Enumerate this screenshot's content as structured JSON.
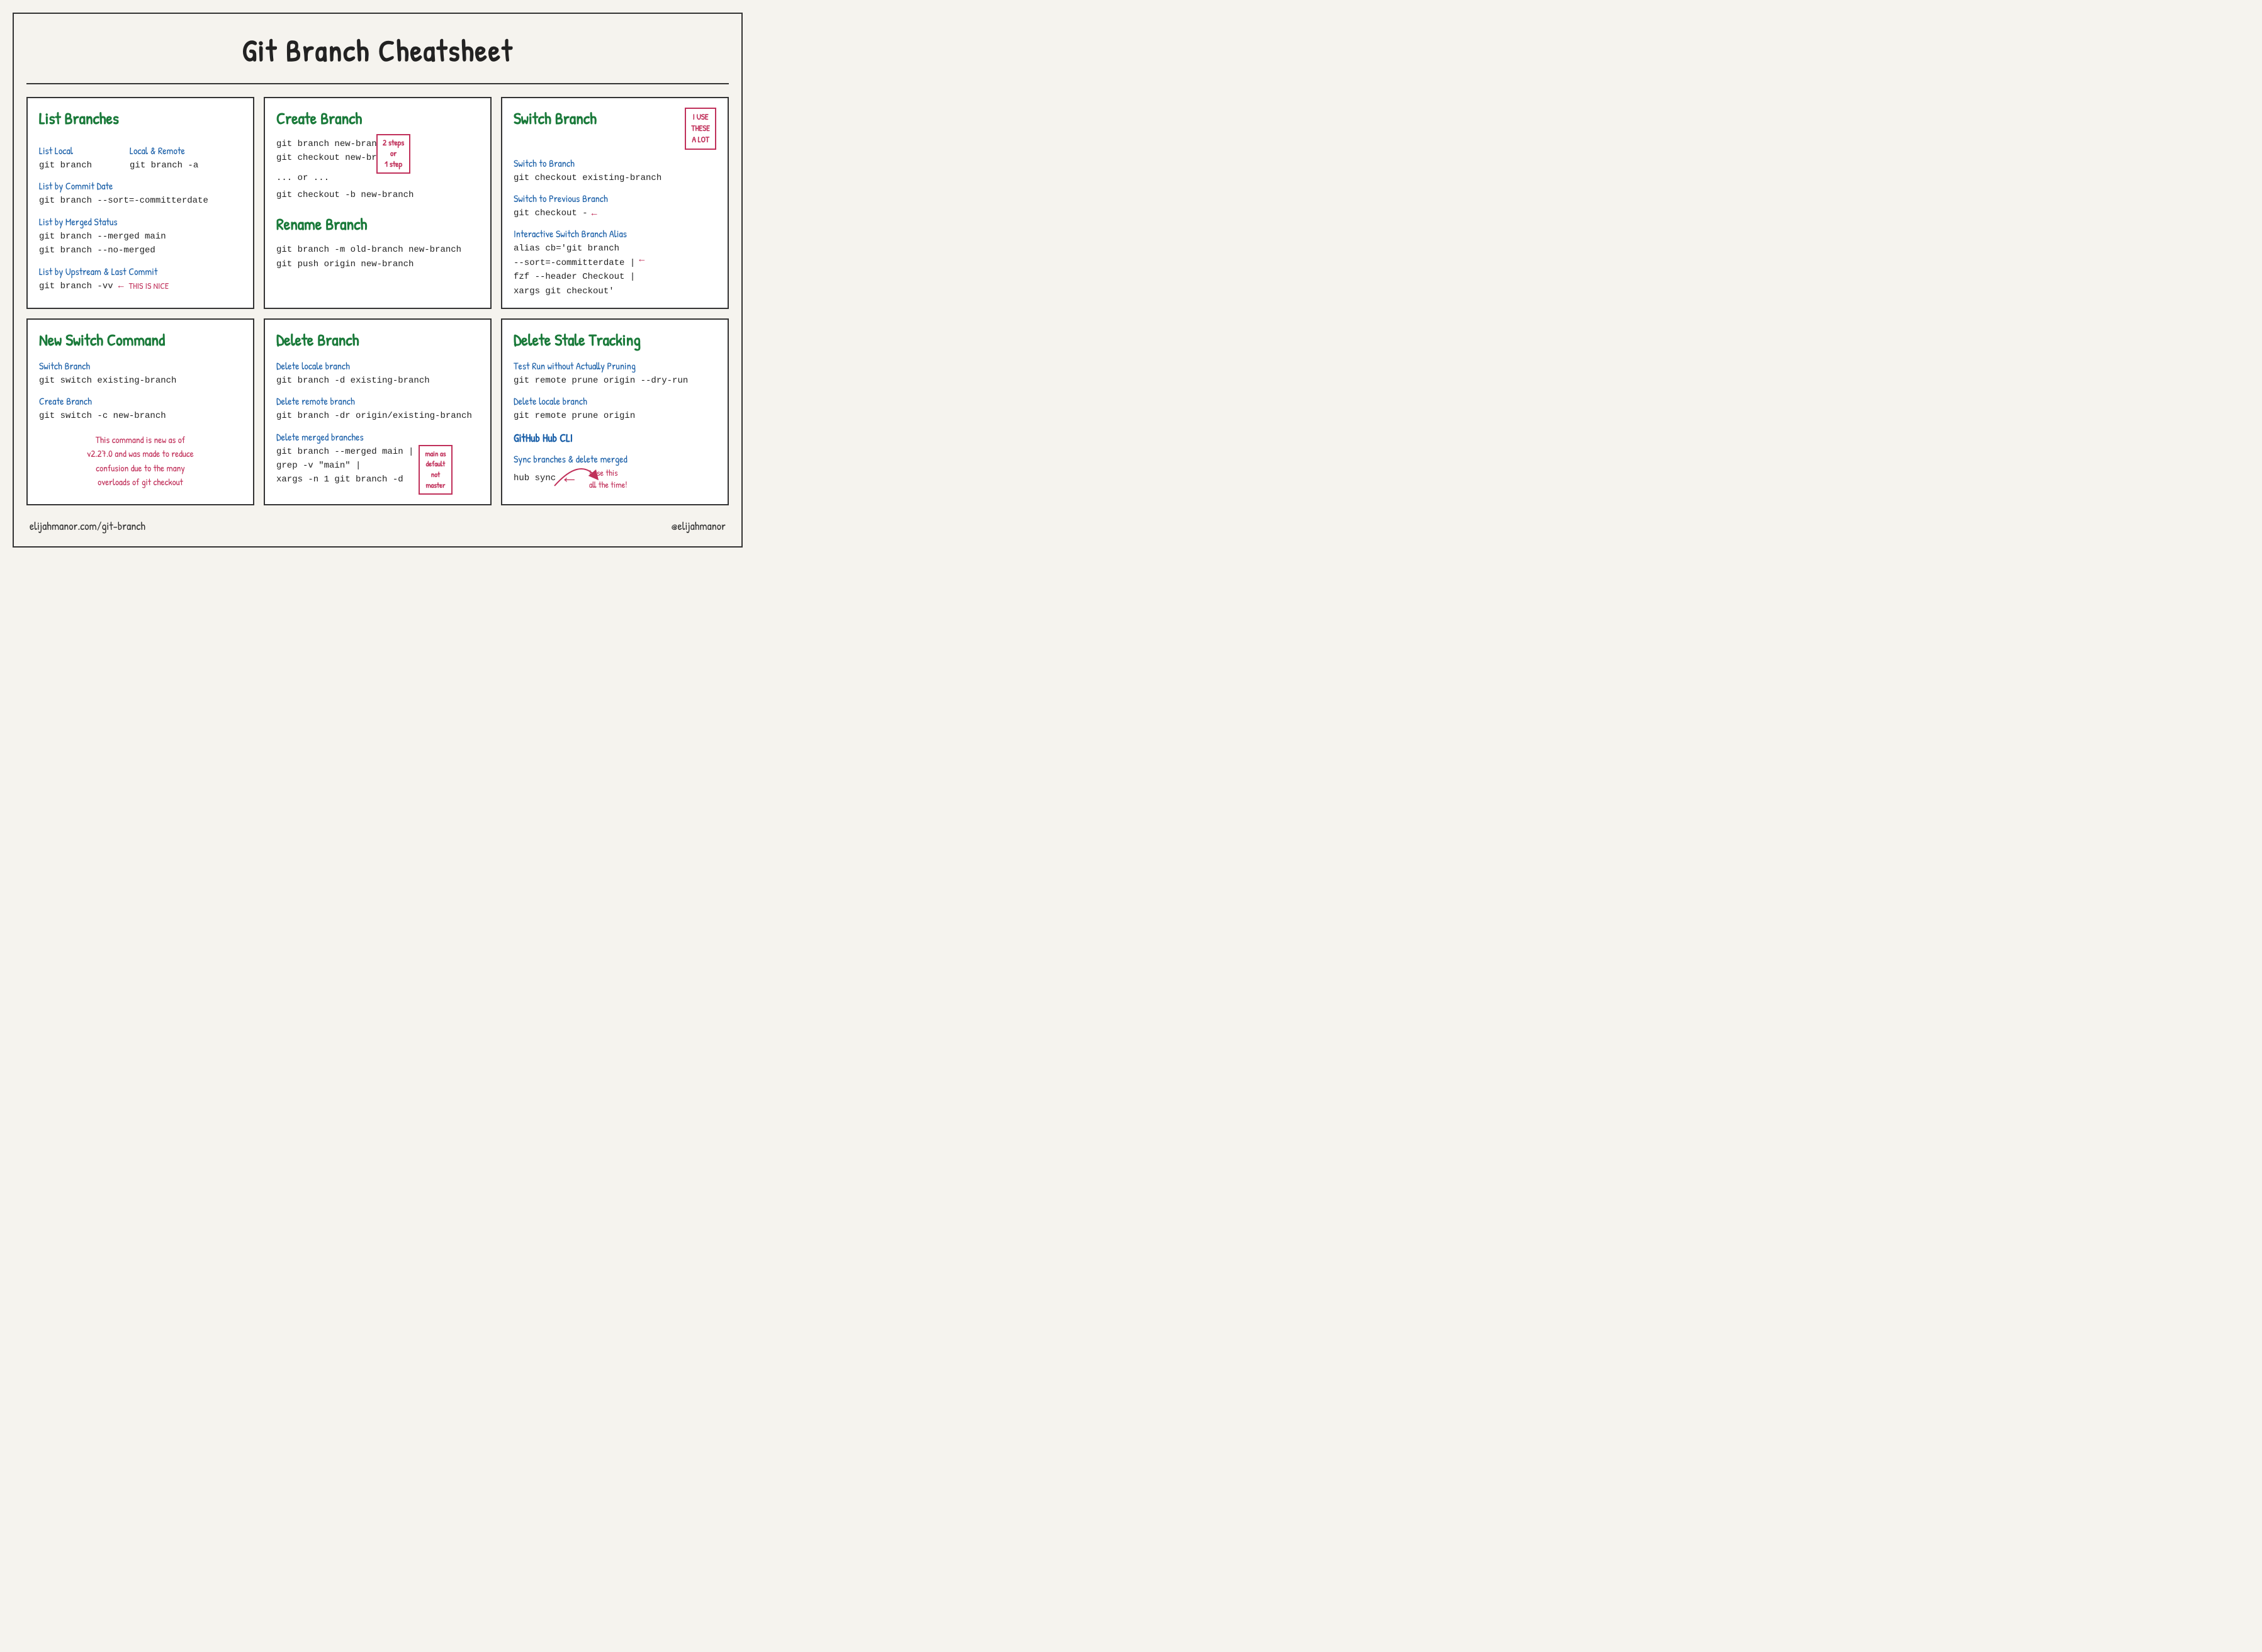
{
  "page": {
    "title": "Git Branch Cheatsheet",
    "footer_left": "elijahmanor.com/git-branch",
    "footer_right": "@elijahmanor"
  },
  "cards": {
    "list_branches": {
      "title": "List Branches",
      "sections": [
        {
          "label": "List Local",
          "label2": "Local & Remote",
          "code1": "git branch",
          "code2": "git branch -a"
        },
        {
          "label": "List by Commit Date",
          "code1": "git branch --sort=-committerdate"
        },
        {
          "label": "List by Merged Status",
          "code1": "git branch --merged main",
          "code2": "git branch --no-merged"
        },
        {
          "label": "List by Upstream & Last Commit",
          "code1": "git branch -vv",
          "annotation": "THIS IS NICE"
        }
      ]
    },
    "create_branch": {
      "title": "Create Branch",
      "code1": "git branch new-branch",
      "code2": "git checkout new-branch",
      "or_text": "... or ...",
      "code3": "git checkout -b new-branch",
      "annotation": "2 steps\nor\n1 step",
      "rename_title": "Rename Branch",
      "rename_code1": "git branch -m old-branch new-branch",
      "rename_code2": "git push origin new-branch"
    },
    "switch_branch": {
      "title": "Switch Branch",
      "badge": "I USE\nTHESE\nA LOT",
      "sections": [
        {
          "label": "Switch to Branch",
          "code": "git checkout existing-branch"
        },
        {
          "label": "Switch to Previous Branch",
          "code": "git checkout -"
        },
        {
          "label": "Interactive Switch Branch Alias",
          "code1": "alias cb='git branch",
          "code2": "--sort=-committerdate |",
          "code3": "fzf --header Checkout |",
          "code4": "xargs git checkout'"
        }
      ]
    },
    "new_switch": {
      "title": "New Switch Command",
      "sections": [
        {
          "label": "Switch Branch",
          "code": "git switch existing-branch"
        },
        {
          "label": "Create Branch",
          "code": "git switch -c new-branch"
        }
      ],
      "note": "This command is new as of\nv2.27.0 and was made to reduce\nconfusion due to the many\noverloads of git checkout"
    },
    "delete_branch": {
      "title": "Delete Branch",
      "sections": [
        {
          "label": "Delete locale branch",
          "code": "git branch -d existing-branch"
        },
        {
          "label": "Delete remote branch",
          "code": "git branch -dr origin/existing-branch"
        },
        {
          "label": "Delete merged branches",
          "code1": "git branch --merged main |",
          "code2": "grep -v \"main\" |",
          "code3": "xargs -n 1 git branch -d"
        }
      ],
      "annotation": "main as\ndefault\nnot\nmaster"
    },
    "delete_stale": {
      "title": "Delete Stale Tracking",
      "sections": [
        {
          "label": "Test Run without Actually Pruning",
          "code": "git remote prune origin --dry-run"
        },
        {
          "label": "Delete locale branch",
          "code": "git remote prune origin"
        },
        {
          "label": "GitHub Hub CLI",
          "sub_label": "Sync branches & delete merged",
          "code": "hub sync"
        }
      ],
      "note": "I use this\nall the time!"
    }
  }
}
